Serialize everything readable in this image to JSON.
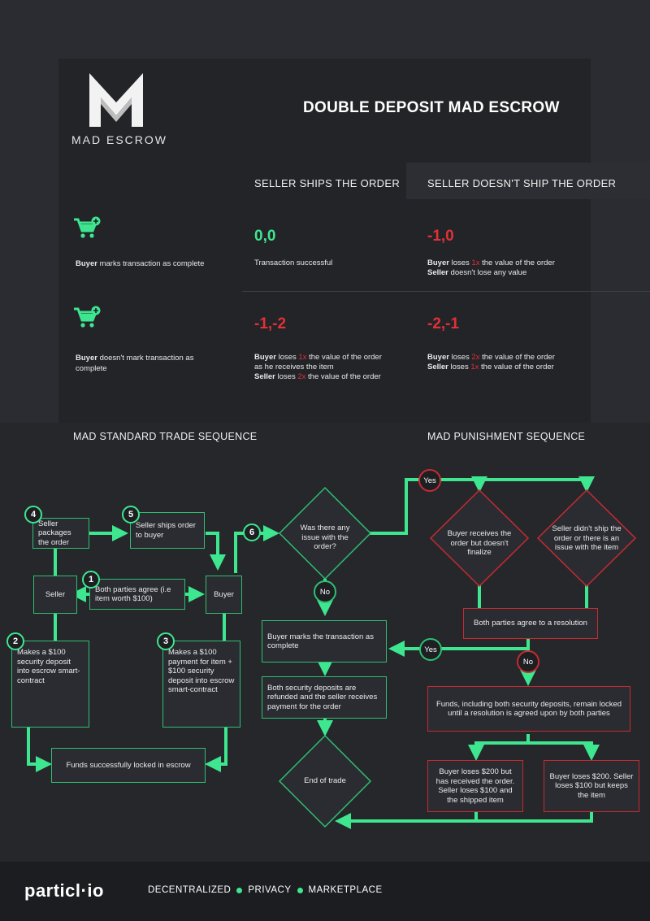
{
  "header": {
    "logo_text": "MAD ESCROW",
    "title": "DOUBLE DEPOSIT MAD ESCROW"
  },
  "matrix": {
    "col1": "SELLER SHIPS THE ORDER",
    "col2": "SELLER DOESN'T SHIP THE ORDER",
    "row1": {
      "bold": "Buyer",
      "rest": " marks transaction as complete"
    },
    "row2": {
      "bold": "Buyer",
      "rest": " doesn't mark transaction as complete"
    },
    "r1c1": {
      "score": "0,0",
      "desc": "Transaction successful"
    },
    "r1c2": {
      "score": "-1,0",
      "l1_bold": "Buyer",
      "l1_a": " loses ",
      "l1_x": "1x",
      "l1_b": " the value of the order",
      "l2_bold": "Seller",
      "l2_a": " doesn't lose any value"
    },
    "r2c1": {
      "score": "-1,-2",
      "l1_bold": "Buyer",
      "l1_a": " loses ",
      "l1_x": "1x",
      "l1_b": " the value of the order",
      "l2": "as he receives the item",
      "l3_bold": "Seller",
      "l3_a": " loses ",
      "l3_x": "2x",
      "l3_b": " the value of the order"
    },
    "r2c2": {
      "score": "-2,-1",
      "l1_bold": "Buyer",
      "l1_a": " loses ",
      "l1_x": "2x",
      "l1_b": " the value of the order",
      "l2_bold": "Seller",
      "l2_a": " loses ",
      "l2_x": "1x",
      "l2_b": " the value of the order"
    }
  },
  "sections": {
    "standard": "MAD STANDARD TRADE SEQUENCE",
    "punishment": "MAD PUNISHMENT SEQUENCE"
  },
  "flow": {
    "b4": "Seller packages the order",
    "b5": "Seller ships order to buyer",
    "seller": "Seller",
    "buyer": "Buyer",
    "b1": "Both parties agree (i.e item worth $100)",
    "b2": "Makes a $100 security deposit into escrow smart-contract",
    "b3": "Makes a $100 payment for item + $100 security deposit into escrow smart-contract",
    "locked": "Funds successfully locked in escrow",
    "d_issue": "Was there any issue with the order?",
    "mark": "Buyer marks the transaction as complete",
    "refund": "Both security deposits are refunded and the seller receives payment for the order",
    "end": "End of trade",
    "d_buyer": "Buyer receives the order but doesn't finalize",
    "d_seller": "Seller didn't ship the order or there is an issue with the item",
    "resolution": "Both parties agree to a resolution",
    "funds_locked": "Funds, including both security deposits, remain locked until a resolution is agreed upon by both parties",
    "lose_left": "Buyer loses $200 but has received the order. Seller loses $100 and the shipped item",
    "lose_right": "Buyer loses $200. Seller loses $100 but keeps the item",
    "yes": "Yes",
    "no": "No",
    "n1": "1",
    "n2": "2",
    "n3": "3",
    "n4": "4",
    "n5": "5",
    "n6": "6"
  },
  "footer": {
    "brand": "particl·io",
    "item1": "DECENTRALIZED",
    "item2": "PRIVACY",
    "item3": "MARKETPLACE"
  },
  "colors": {
    "accent": "#3ee68f",
    "red": "#e03137",
    "bg": "#2a2c31"
  }
}
